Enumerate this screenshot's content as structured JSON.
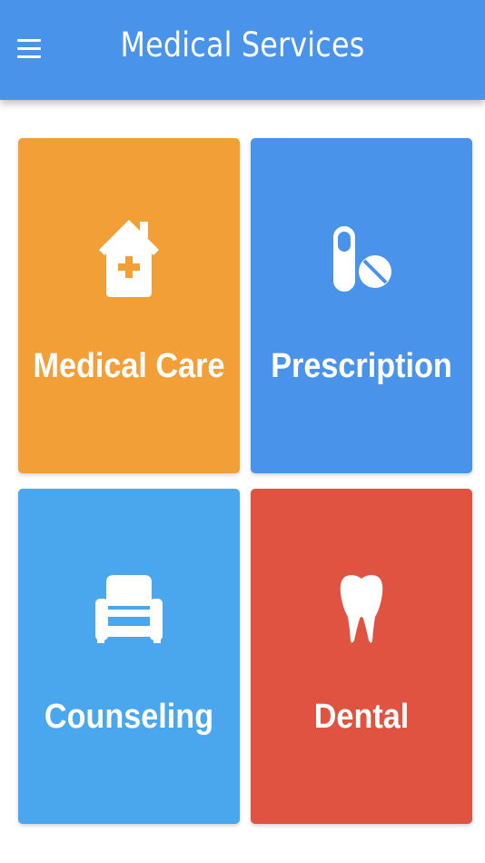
{
  "header": {
    "title": "Medical Services",
    "menu_icon": "hamburger-menu-icon",
    "color": "#4a93ea"
  },
  "tiles": [
    {
      "label": "Medical Care",
      "icon": "clinic-house-icon",
      "color": "#f29f38"
    },
    {
      "label": "Prescription",
      "icon": "pills-icon",
      "color": "#4a93ea"
    },
    {
      "label": "Counseling",
      "icon": "couch-icon",
      "color": "#4aa6ed"
    },
    {
      "label": "Dental",
      "icon": "tooth-icon",
      "color": "#e05341"
    }
  ]
}
